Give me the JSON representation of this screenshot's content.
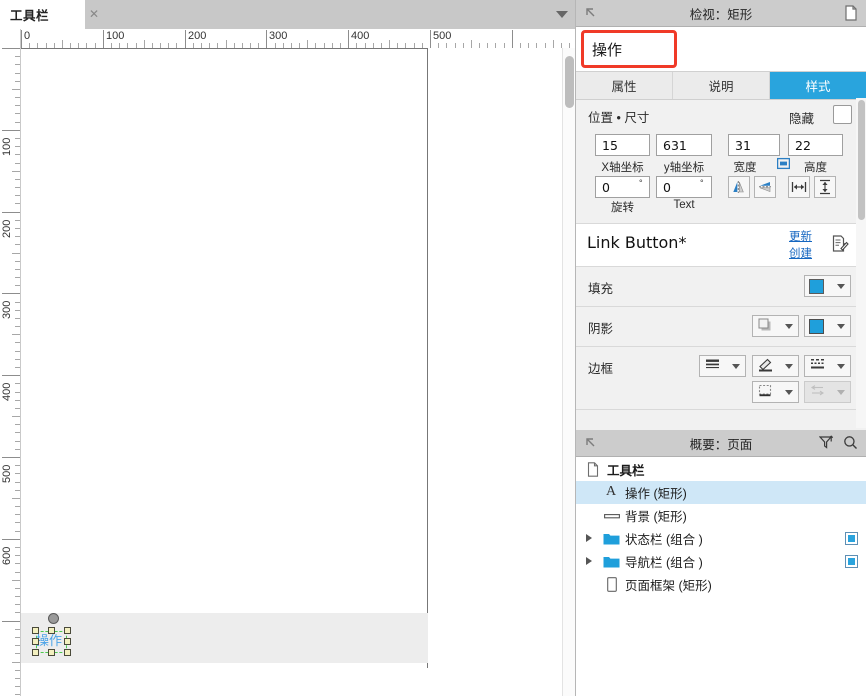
{
  "canvas": {
    "tab": {
      "label": "工具栏",
      "close_icon": "close-icon"
    },
    "hruler_labels": [
      "0",
      "100",
      "200",
      "300",
      "400",
      "500"
    ],
    "vruler_labels": [
      "100",
      "200",
      "300",
      "400",
      "500",
      "600"
    ],
    "selected_widget_text": "操作"
  },
  "inspector": {
    "header": {
      "title": "检视：矩形",
      "back_icon": "arrow-up-left-icon",
      "doc_icon": "page-icon"
    },
    "name_field": {
      "value": "操作"
    },
    "tabs": [
      {
        "label": "属性",
        "active": false
      },
      {
        "label": "说明",
        "active": false
      },
      {
        "label": "样式",
        "active": true
      }
    ],
    "position_size": {
      "title": "位置 • 尺寸",
      "hide_label": "隐藏",
      "x": {
        "value": "15",
        "label": "X轴坐标"
      },
      "y": {
        "value": "631",
        "label": "y轴坐标"
      },
      "width": {
        "value": "31",
        "label": "宽度"
      },
      "height": {
        "value": "22",
        "label": "高度"
      },
      "rotation": {
        "value": "0",
        "unit": "°",
        "label": "旋转"
      },
      "text_rotation": {
        "value": "0",
        "unit": "°",
        "label": "Text"
      },
      "lock_icon": "link-aspect-icon",
      "buttons": [
        "flip-horizontal-icon",
        "flip-vertical-icon",
        "fit-width-icon",
        "fit-height-icon"
      ]
    },
    "widget_style": {
      "name": "Link Button*",
      "update_link": "更新",
      "create_link": "创建",
      "edit_icon": "edit-style-icon",
      "caret_icon": "chevron-down-icon"
    },
    "fill": {
      "label": "填充",
      "color": "#1f9fdb"
    },
    "shadow": {
      "label": "阴影",
      "outer_icon": "outer-shadow-icon",
      "color": "#1f9fdb"
    },
    "border": {
      "label": "边框",
      "line_width_icon": "line-width-icon",
      "line_color_icon": "line-color-icon",
      "line_pattern_icon": "line-pattern-icon",
      "line_visibility_icon": "border-visibility-icon",
      "arrow_icon": "line-arrow-icon"
    }
  },
  "outline": {
    "header": {
      "title": "概要：页面",
      "back_icon": "arrow-up-left-icon",
      "filter_icon": "filter-icon",
      "search_icon": "search-icon"
    },
    "rows": [
      {
        "label": "工具栏",
        "icon": "page-icon",
        "depth": 0,
        "expandable": false,
        "selected": false,
        "right_icon": false
      },
      {
        "label": "操作 (矩形)",
        "icon": "text-a-icon",
        "depth": 1,
        "expandable": false,
        "selected": true,
        "right_icon": false
      },
      {
        "label": "背景 (矩形)",
        "icon": "rect-line-icon",
        "depth": 1,
        "expandable": false,
        "selected": false,
        "right_icon": false
      },
      {
        "label": "状态栏 (组合 )",
        "icon": "folder-icon",
        "depth": 1,
        "expandable": true,
        "selected": false,
        "right_icon": true
      },
      {
        "label": "导航栏 (组合 )",
        "icon": "folder-icon",
        "depth": 1,
        "expandable": true,
        "selected": false,
        "right_icon": true
      },
      {
        "label": "页面框架 (矩形)",
        "icon": "frame-icon",
        "depth": 1,
        "expandable": false,
        "selected": false,
        "right_icon": false
      }
    ]
  },
  "colors": {
    "accent": "#29a4dd",
    "fill_blue": "#1f9fdb",
    "highlight_red": "#f03a28",
    "selection_green": "#4ec94e",
    "row_selected": "#cfe7f7"
  }
}
